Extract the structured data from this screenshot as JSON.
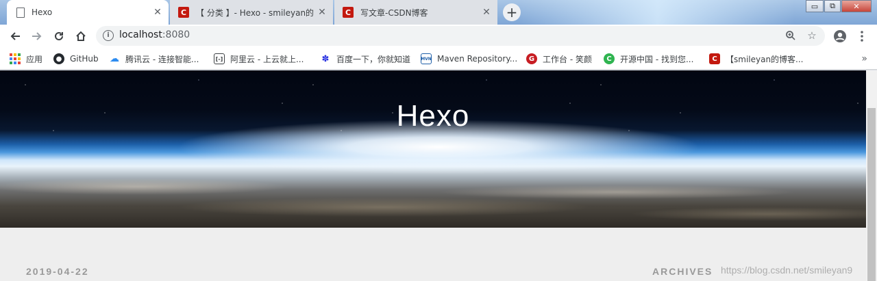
{
  "browser": {
    "tabs": [
      {
        "title": "Hexo",
        "favicon": "doc-icon",
        "active": true
      },
      {
        "title": "【 分类 】- Hexo - smileyan的",
        "favicon": "csdn-icon",
        "active": false
      },
      {
        "title": "写文章-CSDN博客",
        "favicon": "csdn-icon",
        "active": false
      }
    ],
    "new_tab_label": "+",
    "address": {
      "host": "localhost",
      "port": ":8080"
    },
    "bookmarks": [
      {
        "label": "应用",
        "icon": "apps-icon"
      },
      {
        "label": "GitHub",
        "icon": "github-icon"
      },
      {
        "label": "腾讯云 - 连接智能...",
        "icon": "tencent-cloud-icon"
      },
      {
        "label": "阿里云 - 上云就上...",
        "icon": "aliyun-icon"
      },
      {
        "label": "百度一下，你就知道",
        "icon": "baidu-icon"
      },
      {
        "label": "Maven Repository...",
        "icon": "maven-icon"
      },
      {
        "label": "工作台 - 笑颜",
        "icon": "gitee-icon"
      },
      {
        "label": "开源中国 - 找到您...",
        "icon": "oschina-icon"
      },
      {
        "label": "【smileyan的博客...",
        "icon": "csdn-icon"
      }
    ],
    "bookmarks_overflow": "»",
    "colors": {
      "csdn_red": "#c3190f",
      "tab_strip": "#a9c6e6"
    }
  },
  "page": {
    "hero_title": "Hexo",
    "post_date": "2019-04-22",
    "archives_label": "ARCHIVES",
    "watermark": "https://blog.csdn.net/smileyan9"
  }
}
